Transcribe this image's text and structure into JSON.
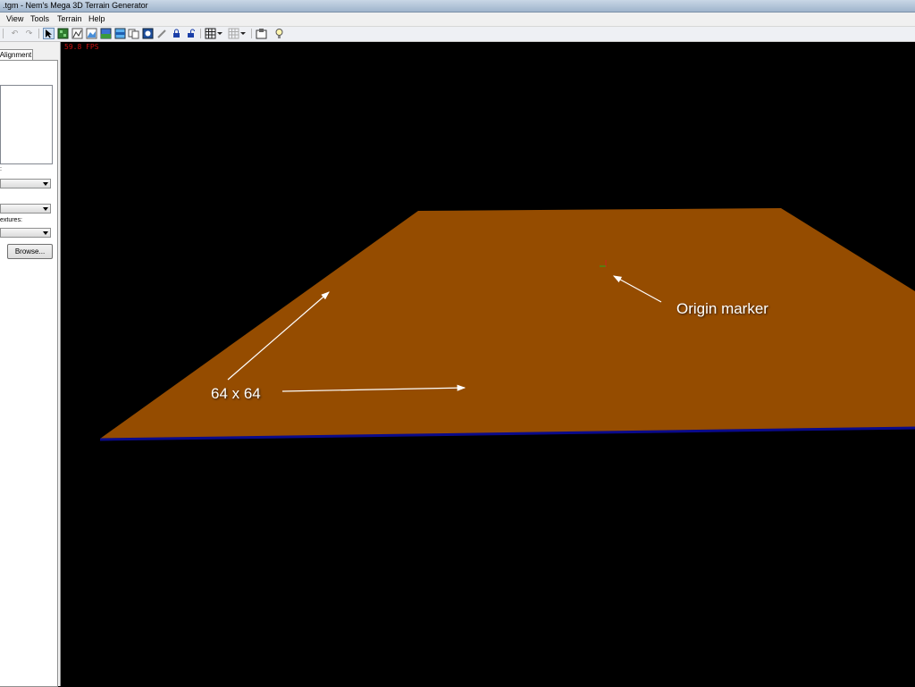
{
  "window": {
    "title": ".tgm - Nem's Mega 3D Terrain Generator"
  },
  "menu": {
    "items": [
      "View",
      "Tools",
      "Terrain",
      "Help"
    ]
  },
  "toolbar": {
    "icons": [
      "select-arrow-icon",
      "terrain-view-icon",
      "wireframe-icon",
      "texture-icon",
      "landscape-icon",
      "water-icon",
      "copy-icon",
      "map-icon",
      "pencil-icon",
      "lock-icon",
      "unlock-icon",
      "grid-icon",
      "grid-options-icon",
      "settings-icon",
      "light-bulb-icon"
    ]
  },
  "sidebar": {
    "tab_label": "Alignment",
    "label_1": ":",
    "label_2": "extures:",
    "browse_label": "Browse..."
  },
  "viewport": {
    "fps_text": "59.8 FPS",
    "origin_label": "Origin marker",
    "size_label": "64 x 64",
    "terrain_color": "#954c00",
    "edge_color": "#0a0a8a"
  }
}
